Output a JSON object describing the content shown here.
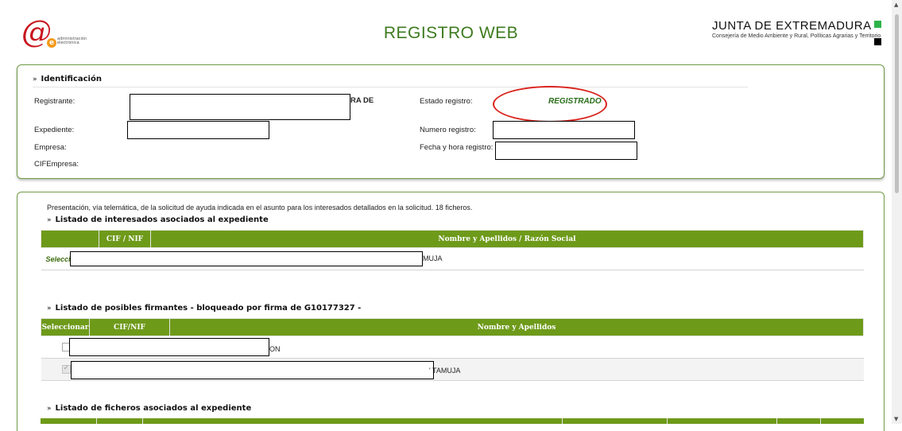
{
  "header": {
    "logo_text": "administración electrónica",
    "title": "REGISTRO WEB",
    "junta_title": "JUNTA DE EXTREMADURA",
    "junta_subtitle": "Consejería de Medio Ambiente y Rural, Políticas Agrarias y Territorio"
  },
  "identificacion": {
    "section_title": "Identificación",
    "registrante_label": "Registrante:",
    "registrante_tail": "RA DE",
    "expediente_label": "Expediente:",
    "empresa_label": "Empresa:",
    "cifempresa_label": "CIFEmpresa:",
    "estado_label": "Estado registro:",
    "estado_value": "REGISTRADO",
    "numero_label": "Numero registro:",
    "fecha_label": "Fecha y hora registro:"
  },
  "main": {
    "description": "Presentación, vía telemática, de la solicitud de ayuda indicada en el asunto para los interesados detallados en la solicitud.  18 ficheros.",
    "interesados": {
      "title": "Listado de interesados asociados al expediente",
      "columns": [
        "",
        "CIF / NIF",
        "Nombre y Apellidos / Razón Social"
      ],
      "rows": [
        {
          "select": "Selecci",
          "name_tail": "MUJA"
        }
      ]
    },
    "firmantes": {
      "title": "Listado de posibles firmantes - bloqueado por firma de G10177327 -",
      "columns": [
        "Seleccionar",
        "CIF/NIF",
        "Nombre y Apellidos"
      ],
      "rows": [
        {
          "checked": false,
          "name_tail": "ON"
        },
        {
          "checked": true,
          "name_tail": "' TAMUJA"
        }
      ]
    },
    "ficheros": {
      "title": "Listado de ficheros asociados al expediente"
    }
  },
  "colors": {
    "accent_green": "#6e9a1a",
    "title_green": "#3d7a1f",
    "status_green": "#2a6e1a",
    "annotation_red": "#d9231d"
  }
}
